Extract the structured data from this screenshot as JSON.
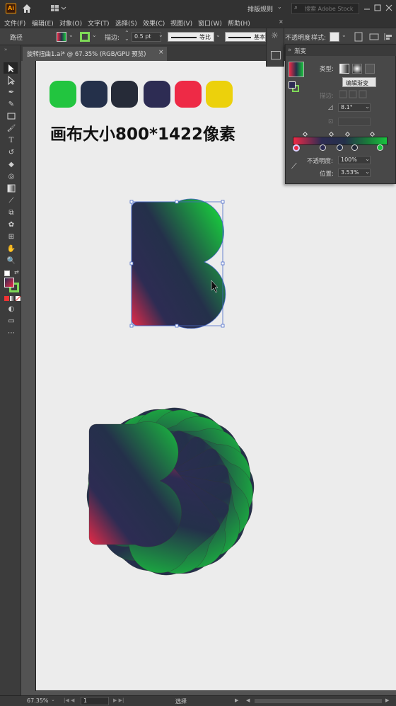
{
  "app": {
    "logo": "Ai"
  },
  "titlebar": {
    "workspace": "排版规则",
    "search_placeholder": "搜索 Adobe Stock"
  },
  "menu": [
    "文件(F)",
    "编辑(E)",
    "对象(O)",
    "文字(T)",
    "选择(S)",
    "效果(C)",
    "视图(V)",
    "窗口(W)",
    "帮助(H)"
  ],
  "control": {
    "object_type": "路径",
    "stroke_label": "描边:",
    "stroke_value": "0.5 pt",
    "profile1": "等比",
    "profile2": "基本",
    "opacity_label": "不透明度",
    "style_label": "样式:"
  },
  "tab": {
    "label": "旋转扭曲1.ai* @ 67.35% (RGB/GPU 预览)",
    "close": "×"
  },
  "artboard": {
    "swatches": [
      "#22c53f",
      "#24304a",
      "#262b38",
      "#2d2c53",
      "#ee2a46",
      "#ecd10c"
    ],
    "heading": "画布大小800*1422像素"
  },
  "gradient_panel": {
    "title": "渐变",
    "type_label": "类型:",
    "edit_button": "编辑渐变",
    "stroke_label": "描边:",
    "angle": "8.1°",
    "opacity_label": "不透明度:",
    "opacity_value": "100%",
    "position_label": "位置:",
    "position_value": "3.53%",
    "colors": {
      "start": "#ee2a46",
      "mid": "#24304a",
      "end": "#19c43e"
    }
  },
  "status": {
    "zoom": "67.35%",
    "page": "1",
    "tool": "选择"
  }
}
